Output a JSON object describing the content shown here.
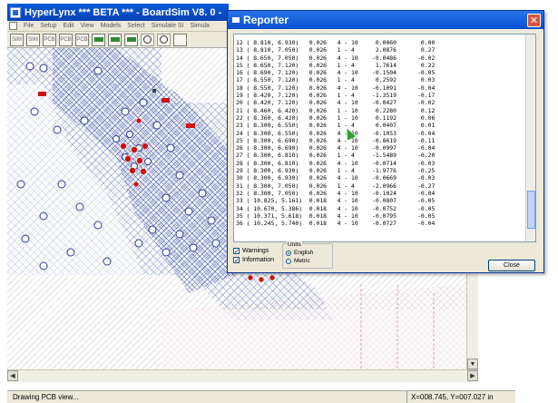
{
  "main_window": {
    "title": "HyperLynx *** BETA *** - BoardSim V8. 0 -",
    "menu": [
      "File",
      "Setup",
      "Edit",
      "View",
      "Models",
      "Select",
      "Simulate SI",
      "Simula"
    ],
    "toolbar_labels": [
      "SIM",
      "SIM",
      "PCB",
      "PCB",
      "PCB"
    ]
  },
  "reporter": {
    "title": "Reporter",
    "close_glyph": "✕",
    "rows": [
      "12 ( 8.810, 6.930)   0.026   4 - 10     0.0060       0.00",
      "13 ( 8.810, 7.050)   0.026   1 - 4      2.0876       0.27",
      "14 ( 8.650, 7.050)   0.026   4 - 10    -0.0486      -0.02",
      "15 ( 8.650, 7.120)   0.026   1 - 4      1.7614       0.22",
      "16 ( 8.690, 7.120)   0.026   4 - 10    -0.1504      -0.05",
      "17 ( 8.550, 7.120)   0.026   1 - 4      0.2592       0.03",
      "18 ( 8.550, 7.120)   0.026   4 - 10    -0.1091      -0.04",
      "19 ( 8.420, 7.120)   0.026   1 - 4     -1.3519      -0.17",
      "20 ( 8.420, 7.120)   0.026   4 - 10    -0.0427      -0.02",
      "21 ( 8.460, 6.420)   0.026   1 - 10     0.2280       0.12",
      "22 ( 8.360, 6.420)   0.026   1 - 10     0.1192       0.06",
      "23 ( 8.300, 6.550)   0.026   1 - 4      0.0407       0.01",
      "24 ( 8.300, 6.550)   0.026   4 - 10    -0.1053      -0.04",
      "25 ( 8.300, 6.690)   0.026   4 - 10    -0.8619      -0.11",
      "26 ( 8.300, 6.690)   0.026   4 - 10    -0.0997      -0.04",
      "27 ( 8.300, 6.810)   0.026   1 - 4     -1.5489      -0.20",
      "28 ( 8.300, 6.810)   0.026   4 - 10    -0.0714      -0.03",
      "29 ( 8.300, 6.930)   0.026   1 - 4     -1.9776      -0.25",
      "30 ( 8.300, 6.930)   0.026   4 - 10    -0.0669      -0.03",
      "31 ( 8.300, 7.050)   0.026   1 - 4     -2.0966      -0.27",
      "32 ( 8.300, 7.050)   0.026   4 - 10    -0.1024      -0.04",
      "33 ( 10.825, 5.161)  0.018   4 - 10    -0.0807      -0.05",
      "34 ( 10.670, 5.386)  0.018   4 - 10    -0.0752      -0.05",
      "35 ( 10.371, 5.618)  0.018   4 - 10    -0.0795      -0.05",
      "36 ( 10.245, 5.740)  0.018   4 - 10    -0.0727      -0.04"
    ],
    "warnings_label": "Warnings",
    "information_label": "Information",
    "units_label": "Units",
    "english_label": "English",
    "metric_label": "Metric",
    "close_button": "Close"
  },
  "status": {
    "left": "Drawing PCB view...",
    "coords": "X=008.745, Y=007.027 in"
  },
  "colors": {
    "title_blue": "#0a5ad8",
    "hatch_blue": "#1d2f9c",
    "via_red": "#cc1111",
    "dialog_bg": "#ece9d8"
  }
}
